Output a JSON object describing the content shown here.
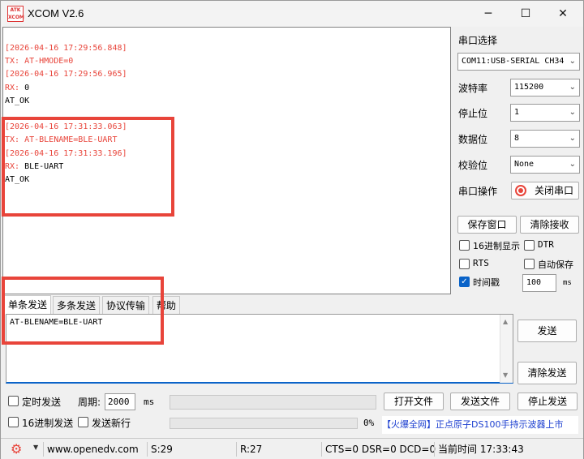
{
  "window": {
    "title": "XCOM V2.6",
    "icon_text_top": "ATK",
    "icon_text_bottom": "XCOM",
    "minimize": "─",
    "maximize": "☐",
    "close": "✕"
  },
  "receive": {
    "lines": [
      {
        "text": "[2026-04-16 17:29:56.848]",
        "kind": "ts"
      },
      {
        "text": "TX: AT-HMODE=0",
        "kind": "tx"
      },
      {
        "text": "[2026-04-16 17:29:56.965]",
        "kind": "ts"
      },
      {
        "prefix": "RX:",
        "text": " 0",
        "kind": "rx"
      },
      {
        "text": "AT_OK",
        "kind": "plain"
      },
      {
        "text": "",
        "kind": "plain"
      },
      {
        "text": "[2026-04-16 17:31:33.063]",
        "kind": "ts"
      },
      {
        "text": "TX: AT-BLENAME=BLE-UART",
        "kind": "tx"
      },
      {
        "text": "[2026-04-16 17:31:33.196]",
        "kind": "ts"
      },
      {
        "prefix": "RX:",
        "text": " BLE-UART",
        "kind": "rx"
      },
      {
        "text": "AT_OK",
        "kind": "plain"
      }
    ]
  },
  "settings": {
    "port_label": "串口选择",
    "port_value": "COM11:USB-SERIAL CH34",
    "baud_label": "波特率",
    "baud_value": "115200",
    "stop_label": "停止位",
    "stop_value": "1",
    "data_label": "数据位",
    "data_value": "8",
    "parity_label": "校验位",
    "parity_value": "None",
    "op_label": "串口操作",
    "op_button": "关闭串口",
    "save_window": "保存窗口",
    "clear_receive": "清除接收",
    "hex_display": "16进制显示",
    "dtr": "DTR",
    "rts": "RTS",
    "auto_save": "自动保存",
    "timestamp": "时间戳",
    "timestamp_value": "100",
    "timestamp_unit": "ms"
  },
  "tabs": [
    "单条发送",
    "多条发送",
    "协议传输",
    "帮助"
  ],
  "send": {
    "text": "AT-BLENAME=BLE-UART",
    "send_button": "发送",
    "clear_send": "清除发送",
    "timed_send": "定时发送",
    "period_label": "周期:",
    "period_value": "2000",
    "period_unit": "ms",
    "open_file": "打开文件",
    "send_file": "发送文件",
    "stop_send": "停止发送",
    "hex_send": "16进制发送",
    "send_newline": "发送新行",
    "progress_percent": "0%",
    "promo": "【火爆全网】正点原子DS100手持示波器上市"
  },
  "statusbar": {
    "url": "www.openedv.com",
    "sent": "S:29",
    "received": "R:27",
    "lines": "CTS=0 DSR=0 DCD=0",
    "time": "当前时间 17:33:43"
  }
}
